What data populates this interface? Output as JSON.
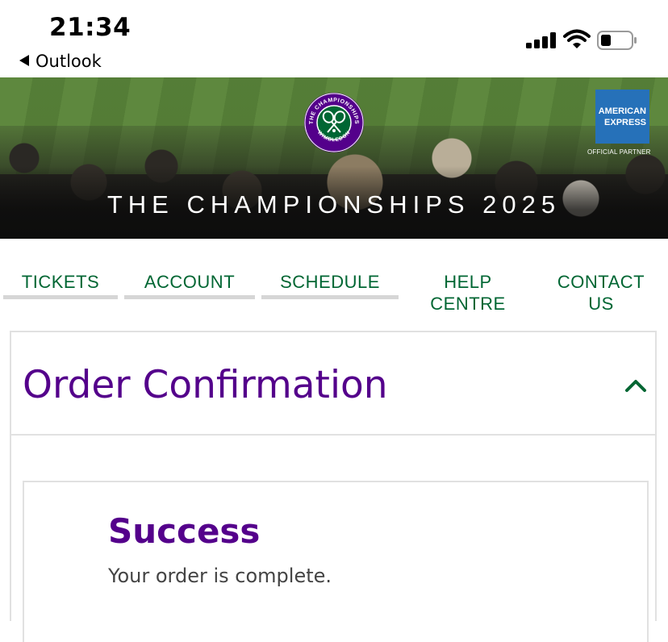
{
  "status_bar": {
    "time": "21:34",
    "back_label": "Outlook"
  },
  "hero": {
    "title": "THE CHAMPIONSHIPS 2025",
    "logo_text": "THE CHAMPIONSHIPS WIMBLEDON",
    "sponsor": {
      "line1": "AMERICAN",
      "line2": "EXPRESS",
      "tag": "OFFICIAL PARTNER"
    }
  },
  "nav": {
    "items": [
      {
        "label": "TICKETS"
      },
      {
        "label": "ACCOUNT"
      },
      {
        "label": "SCHEDULE"
      },
      {
        "label": "HELP CENTRE"
      },
      {
        "label": "CONTACT US"
      }
    ]
  },
  "main": {
    "title": "Order Confirmation",
    "success": {
      "heading": "Success",
      "message": "Your order is complete."
    }
  },
  "colors": {
    "brand_purple": "#54008b",
    "brand_green": "#006633",
    "amex_blue": "#2671b9"
  }
}
